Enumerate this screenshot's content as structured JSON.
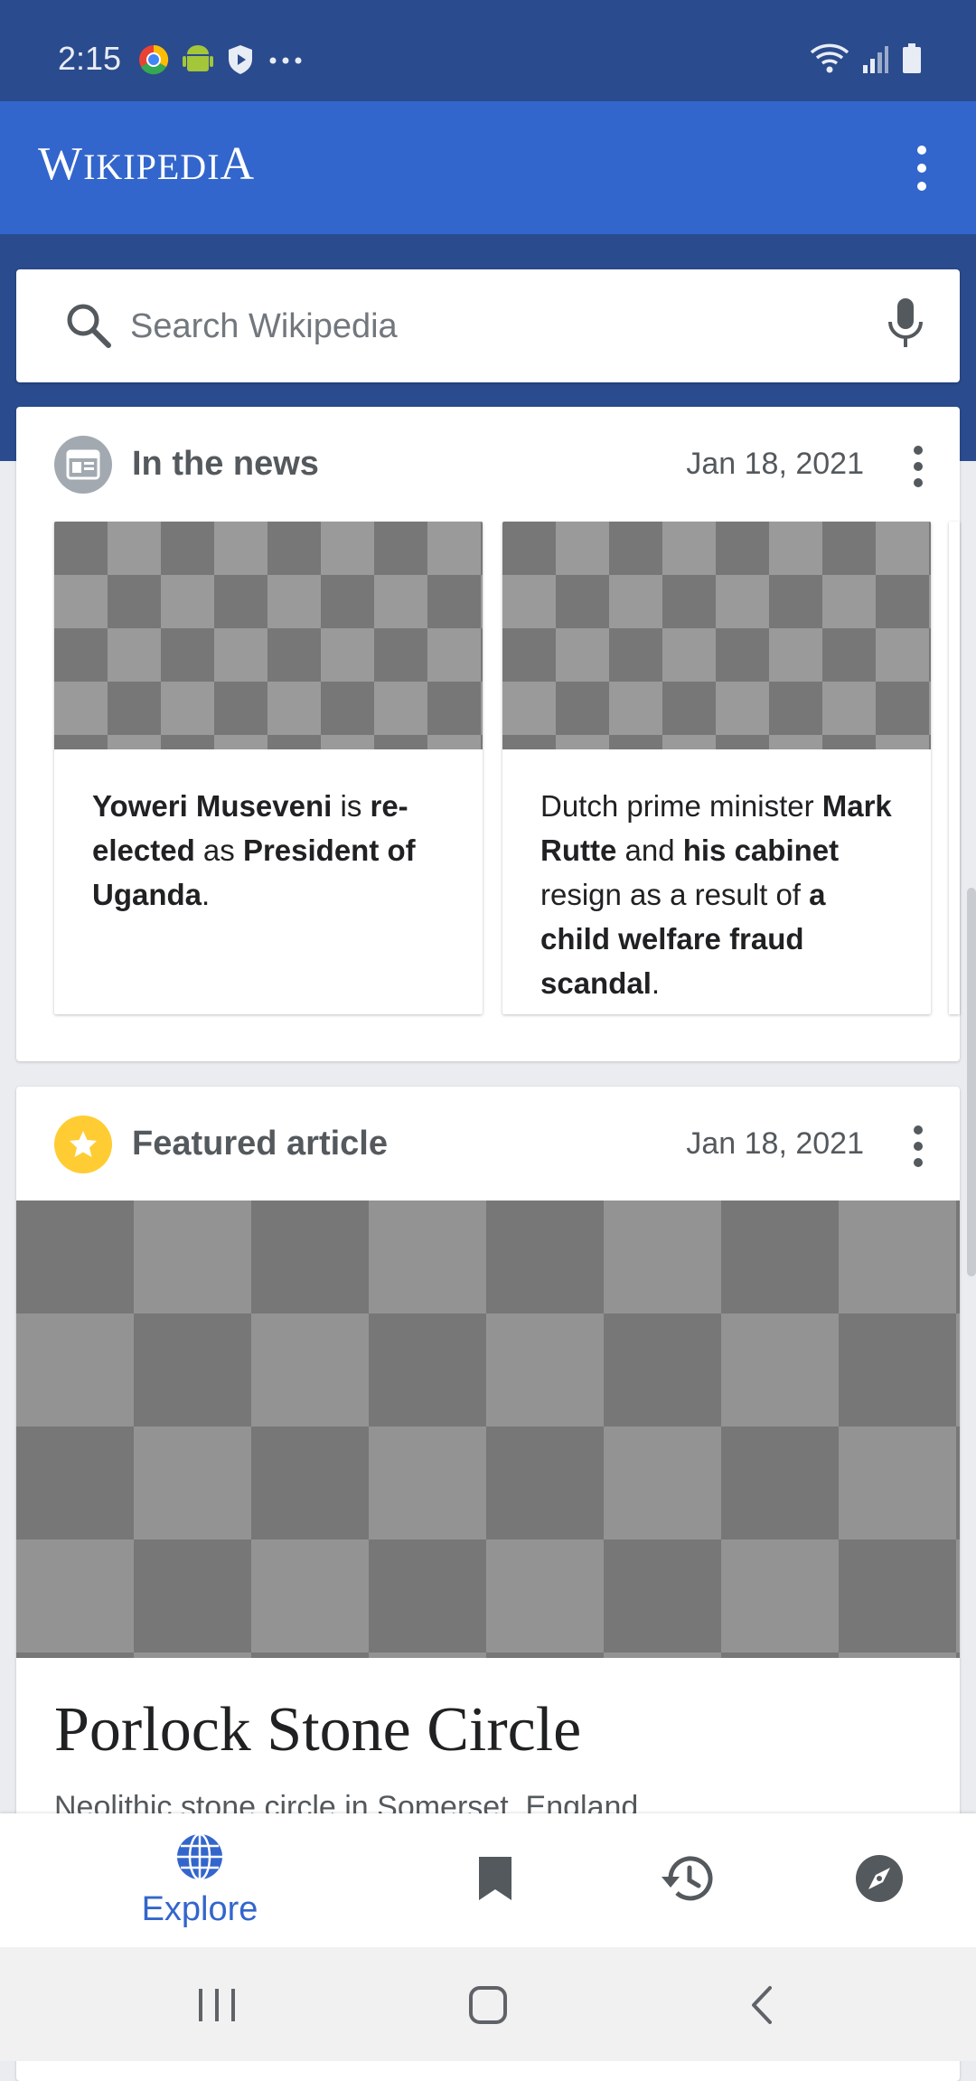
{
  "status_bar": {
    "time": "2:15",
    "left_icons": [
      "chrome-icon",
      "android-icon",
      "shield-icon",
      "more-dots-icon"
    ],
    "right_icons": [
      "wifi-icon",
      "signal-icon",
      "battery-icon"
    ]
  },
  "app_bar": {
    "title_first": "W",
    "title_rest": "IKIPEDI",
    "title_last": "A",
    "menu_icon": "overflow-menu-icon"
  },
  "search": {
    "placeholder": "Search Wikipedia",
    "icon": "search-icon",
    "voice_icon": "mic-icon"
  },
  "news_card": {
    "title": "In the news",
    "date": "Jan 18, 2021",
    "icon": "newspaper-icon",
    "items": [
      {
        "parts": [
          {
            "text": "Yoweri Museveni",
            "bold": true
          },
          {
            "text": " is ",
            "bold": false
          },
          {
            "text": "re-elected",
            "bold": true
          },
          {
            "text": " as ",
            "bold": false
          },
          {
            "text": "President of Uganda",
            "bold": true
          },
          {
            "text": ".",
            "bold": false
          }
        ]
      },
      {
        "parts": [
          {
            "text": "Dutch prime minister ",
            "bold": false
          },
          {
            "text": "Mark Rutte",
            "bold": true
          },
          {
            "text": " and ",
            "bold": false
          },
          {
            "text": "his cabinet",
            "bold": true
          },
          {
            "text": " resign as a result of ",
            "bold": false
          },
          {
            "text": "a child welfare fraud scandal",
            "bold": true
          },
          {
            "text": ".",
            "bold": false
          }
        ]
      }
    ]
  },
  "featured_card": {
    "title": "Featured article",
    "date": "Jan 18, 2021",
    "icon": "star-icon",
    "article_title": "Porlock Stone Circle",
    "article_description": "Neolithic stone circle in Somerset, England"
  },
  "bottom_nav": {
    "items": [
      {
        "label": "Explore",
        "icon": "globe-icon",
        "active": true
      },
      {
        "label": "",
        "icon": "bookmark-icon",
        "active": false
      },
      {
        "label": "",
        "icon": "history-icon",
        "active": false
      },
      {
        "label": "",
        "icon": "compass-icon",
        "active": false
      }
    ]
  },
  "system_nav": {
    "items": [
      "recents-icon",
      "home-icon",
      "back-icon"
    ]
  },
  "colors": {
    "status_bar": "#2a4b8d",
    "app_bar": "#3366cc",
    "accent": "#3366cc",
    "star": "#ffcc33",
    "text_primary": "#202122",
    "text_secondary": "#54595d"
  }
}
